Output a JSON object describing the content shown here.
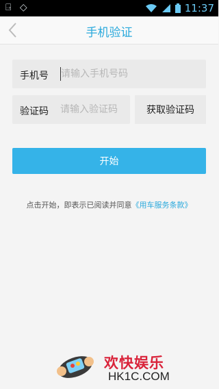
{
  "status_bar": {
    "time": "11:37",
    "left_icons": [
      "usb-icon",
      "settings-icon"
    ],
    "right_icons": [
      "wifi-icon",
      "signal-icon",
      "battery-icon"
    ]
  },
  "header": {
    "title": "手机验证",
    "back_icon": "chevron-left-icon"
  },
  "form": {
    "phone": {
      "label": "手机号",
      "placeholder": "请输入手机号码",
      "value": ""
    },
    "code": {
      "label": "验证码",
      "placeholder": "请输入验证码",
      "value": ""
    },
    "get_code_label": "获取验证码",
    "start_label": "开始"
  },
  "agreement": {
    "prefix": "点击开始，即表示已阅读并同意",
    "link": "《用车服务条款》"
  },
  "watermark": {
    "cn": "欢快娱乐",
    "en": "HK1C.COM"
  },
  "colors": {
    "accent": "#35b3e8",
    "title": "#2aa9dc",
    "field_bg": "#eaeaea",
    "page_bg": "#f4f4f4"
  }
}
